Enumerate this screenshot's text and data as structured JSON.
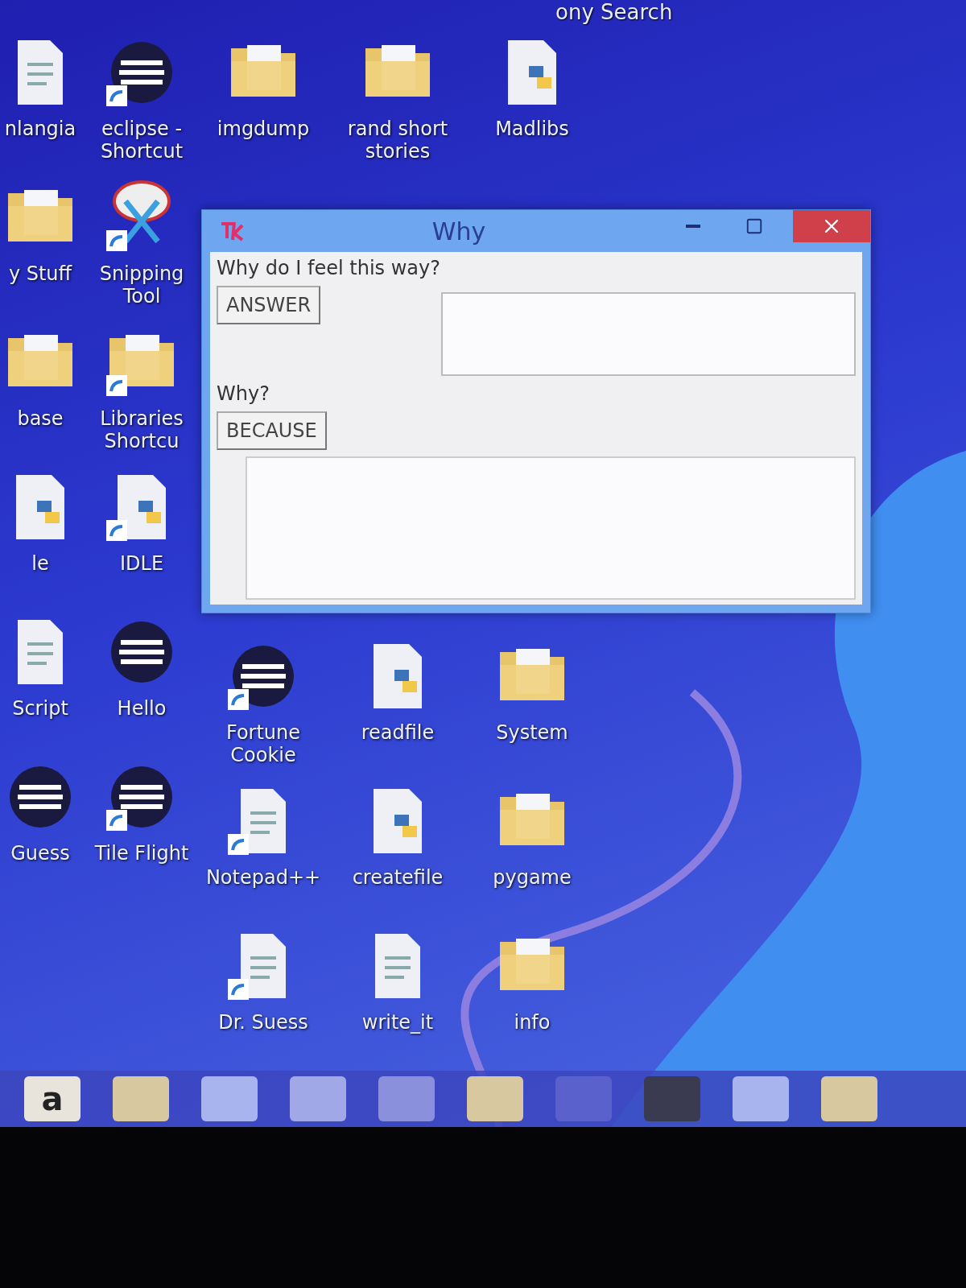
{
  "top_label": "ony Search",
  "desktop_columns": [
    {
      "top": [
        {
          "label": "nlangia",
          "kind": "document",
          "shortcut": false
        },
        {
          "label": "y Stuff",
          "kind": "folder",
          "shortcut": false
        },
        {
          "label": "base",
          "kind": "folder",
          "shortcut": false
        },
        {
          "label": "le",
          "kind": "python",
          "shortcut": false
        },
        {
          "label": "Script",
          "kind": "document",
          "shortcut": false
        },
        {
          "label": "Guess",
          "kind": "app",
          "shortcut": false
        }
      ]
    },
    {
      "top": [
        {
          "label": "eclipse - Shortcut",
          "kind": "app",
          "shortcut": true
        },
        {
          "label": "Snipping Tool",
          "kind": "scissors",
          "shortcut": true
        },
        {
          "label": "Libraries Shortcu",
          "kind": "folder",
          "shortcut": true
        },
        {
          "label": "IDLE",
          "kind": "python",
          "shortcut": true
        },
        {
          "label": "Hello",
          "kind": "app",
          "shortcut": false
        },
        {
          "label": "Tile Flight",
          "kind": "app",
          "shortcut": true
        }
      ]
    },
    {
      "top": [
        {
          "label": "imgdump",
          "kind": "folder",
          "shortcut": false
        }
      ],
      "bottom": [
        {
          "label": "Fortune Cookie",
          "kind": "app",
          "shortcut": true
        },
        {
          "label": "Notepad++",
          "kind": "document",
          "shortcut": true
        },
        {
          "label": "Dr. Suess",
          "kind": "document",
          "shortcut": true
        }
      ]
    },
    {
      "top": [
        {
          "label": "rand short stories",
          "kind": "folder",
          "shortcut": false
        }
      ],
      "bottom": [
        {
          "label": "readfile",
          "kind": "python",
          "shortcut": false
        },
        {
          "label": "createfile",
          "kind": "python",
          "shortcut": false
        },
        {
          "label": "write_it",
          "kind": "document",
          "shortcut": false
        }
      ]
    },
    {
      "top": [
        {
          "label": "Madlibs",
          "kind": "python",
          "shortcut": false
        }
      ],
      "bottom": [
        {
          "label": "System",
          "kind": "folder",
          "shortcut": false
        },
        {
          "label": "pygame",
          "kind": "folder",
          "shortcut": false
        },
        {
          "label": "info",
          "kind": "folder",
          "shortcut": false
        }
      ]
    }
  ],
  "window": {
    "title": "Why",
    "question": "Why do I feel this way?",
    "answer_button": "ANSWER",
    "why_label": "Why?",
    "because_button": "BECAUSE"
  },
  "taskbar": [
    {
      "kind": "letter",
      "glyph": "a"
    },
    {
      "kind": "app"
    },
    {
      "kind": "folder"
    },
    {
      "kind": "media"
    },
    {
      "kind": "paint"
    },
    {
      "kind": "app"
    },
    {
      "kind": "dots"
    },
    {
      "kind": "photo"
    },
    {
      "kind": "folder"
    },
    {
      "kind": "app"
    }
  ]
}
